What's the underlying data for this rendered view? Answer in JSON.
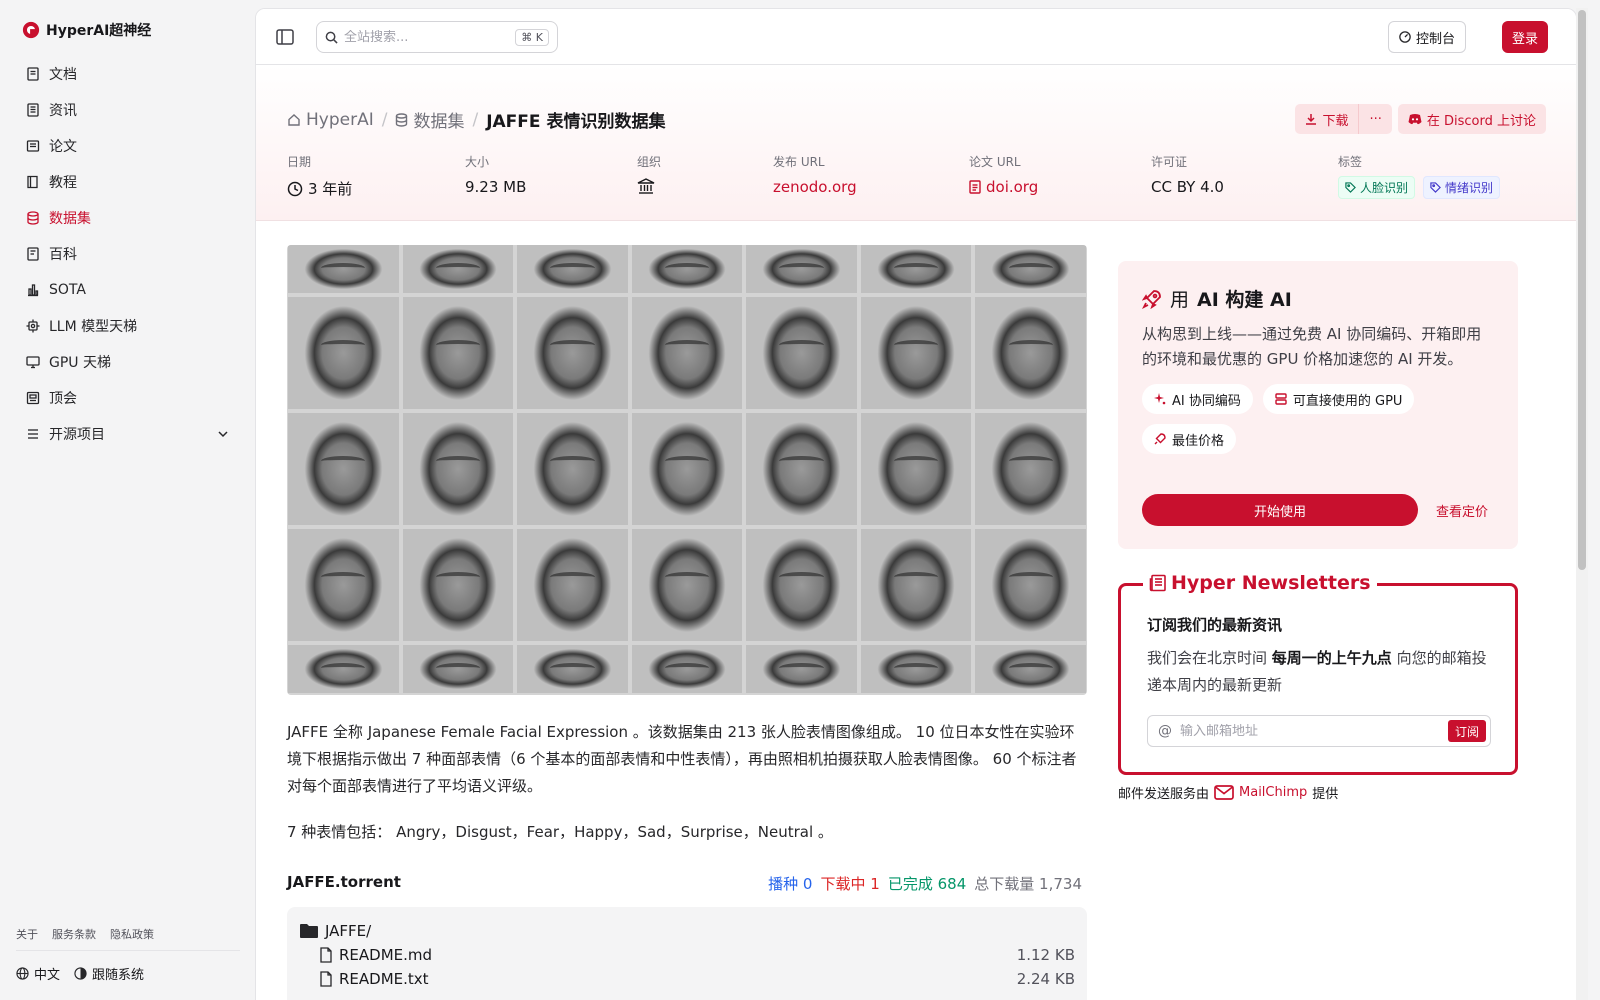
{
  "brand": {
    "name": "HyperAI超神经"
  },
  "nav": [
    {
      "label": "文档",
      "icon": "doc-icon"
    },
    {
      "label": "资讯",
      "icon": "news-icon"
    },
    {
      "label": "论文",
      "icon": "paper-icon"
    },
    {
      "label": "教程",
      "icon": "book-icon"
    },
    {
      "label": "数据集",
      "icon": "database-icon",
      "active": true
    },
    {
      "label": "百科",
      "icon": "wiki-icon"
    },
    {
      "label": "SOTA",
      "icon": "bar-chart-icon"
    },
    {
      "label": "LLM 模型天梯",
      "icon": "chip-icon"
    },
    {
      "label": "GPU 天梯",
      "icon": "monitor-icon"
    },
    {
      "label": "顶会",
      "icon": "conference-icon"
    },
    {
      "label": "开源项目",
      "icon": "list-icon",
      "expandable": true
    }
  ],
  "footer_links": [
    "关于",
    "服务条款",
    "隐私政策"
  ],
  "footer_bottom": {
    "language": "中文",
    "theme": "跟随系统"
  },
  "topbar": {
    "search_placeholder": "全站搜索...",
    "search_shortcut": "⌘ K",
    "console_label": "控制台",
    "login_label": "登录"
  },
  "breadcrumb": {
    "home": "HyperAI",
    "section": "数据集",
    "current": "JAFFE 表情识别数据集"
  },
  "actions": {
    "download": "下载",
    "more": "···",
    "discord": "在 Discord 上讨论"
  },
  "meta": {
    "date_label": "日期",
    "date_value": "3 年前",
    "size_label": "大小",
    "size_value": "9.23 MB",
    "org_label": "组织",
    "release_label": "发布 URL",
    "release_value": "zenodo.org",
    "paper_label": "论文 URL",
    "paper_value": "doi.org",
    "license_label": "许可证",
    "license_value": "CC BY 4.0",
    "tags_label": "标签",
    "tags": [
      "人脸识别",
      "情绪识别"
    ]
  },
  "description": {
    "p1": "JAFFE 全称 Japanese Female Facial Expression 。该数据集由 213 张人脸表情图像组成。 10 位日本女性在实验环境下根据指示做出 7 种面部表情（6 个基本的面部表情和中性表情），再由照相机拍摄获取人脸表情图像。 60 个标注者对每个面部表情进行了平均语义评级。",
    "p2": "7 种表情包括： Angry，Disgust，Fear，Happy，Sad，Surprise，Neutral 。"
  },
  "torrent": {
    "title": "JAFFE.torrent",
    "seed_label": "播种",
    "seed": "0",
    "downloading_label": "下载中",
    "downloading": "1",
    "done_label": "已完成",
    "done": "684",
    "total_label": "总下载量",
    "total": "1,734",
    "folder": "JAFFE/",
    "files": [
      {
        "name": "README.md",
        "size": "1.12 KB"
      },
      {
        "name": "README.txt",
        "size": "2.24 KB"
      }
    ]
  },
  "ai_card": {
    "title_prefix": "用",
    "title_bold": "AI 构建 AI",
    "desc": "从构思到上线——通过免费 AI 协同编码、开箱即用的环境和最优惠的 GPU 价格加速您的 AI 开发。",
    "chips": [
      "AI 协同编码",
      "可直接使用的 GPU",
      "最佳价格"
    ],
    "start_label": "开始使用",
    "pricing_label": "查看定价"
  },
  "newsletter": {
    "title": "Hyper Newsletters",
    "subtitle": "订阅我们的最新资讯",
    "desc_pre": "我们会在北京时间",
    "desc_bold": "每周一的上午九点",
    "desc_post": "向您的邮箱投递本周内的最新更新",
    "email_placeholder": "输入邮箱地址",
    "subscribe_label": "订阅",
    "provider_pre": "邮件发送服务由",
    "provider_name": "MailChimp",
    "provider_post": "提供"
  }
}
